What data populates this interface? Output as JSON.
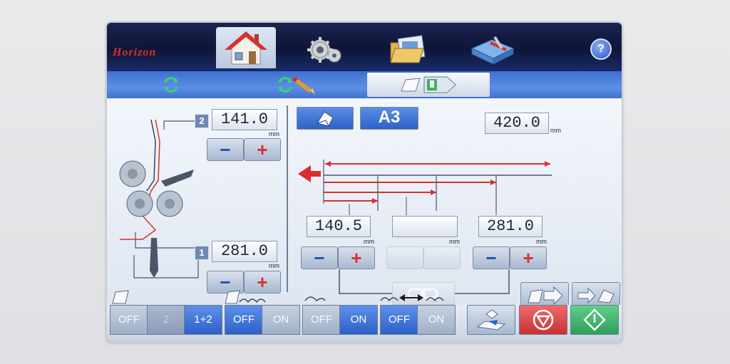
{
  "brand": {
    "name": "Horizon"
  },
  "tabs": [
    {
      "name": "home",
      "icon": "house-icon",
      "active": true
    },
    {
      "name": "settings",
      "icon": "gears-icon",
      "active": false
    },
    {
      "name": "jobs",
      "icon": "folder-files-icon",
      "active": false
    },
    {
      "name": "tools",
      "icon": "toolbox-icon",
      "active": false
    }
  ],
  "help": {
    "label": "?"
  },
  "subbar": {
    "items": [
      {
        "icon": "refresh-icon"
      },
      {
        "icon": "refresh-pencil-icon"
      },
      {
        "icon": "folder-hand-arrow-icon",
        "active": true
      }
    ]
  },
  "left_panel": {
    "fold2": {
      "index": "2",
      "value": "141.0",
      "unit": "mm"
    },
    "fold1": {
      "index": "1",
      "value": "281.0",
      "unit": "mm"
    },
    "minus_label": "−",
    "plus_label": "+"
  },
  "right_panel": {
    "paper_size": "A3",
    "length": {
      "value": "420.0",
      "unit": "mm"
    },
    "pos_a": {
      "value": "140.5",
      "unit": "mm"
    },
    "pos_b": {
      "value": "",
      "unit": "mm"
    },
    "pos_c": {
      "value": "281.0",
      "unit": "mm"
    },
    "minus_label": "−",
    "plus_label": "+"
  },
  "bottom": {
    "group1": {
      "off": "OFF",
      "mid": "2",
      "on": "1+2"
    },
    "group2": {
      "off": "OFF",
      "on": "ON"
    },
    "group3": {
      "off": "OFF",
      "on": "ON"
    },
    "group4": {
      "off": "OFF",
      "on": "ON"
    }
  },
  "colors": {
    "accent": "#2f62c8",
    "arrow_red": "#d8302c",
    "stop_red": "#d84a4a",
    "start_green": "#3ab56a"
  }
}
